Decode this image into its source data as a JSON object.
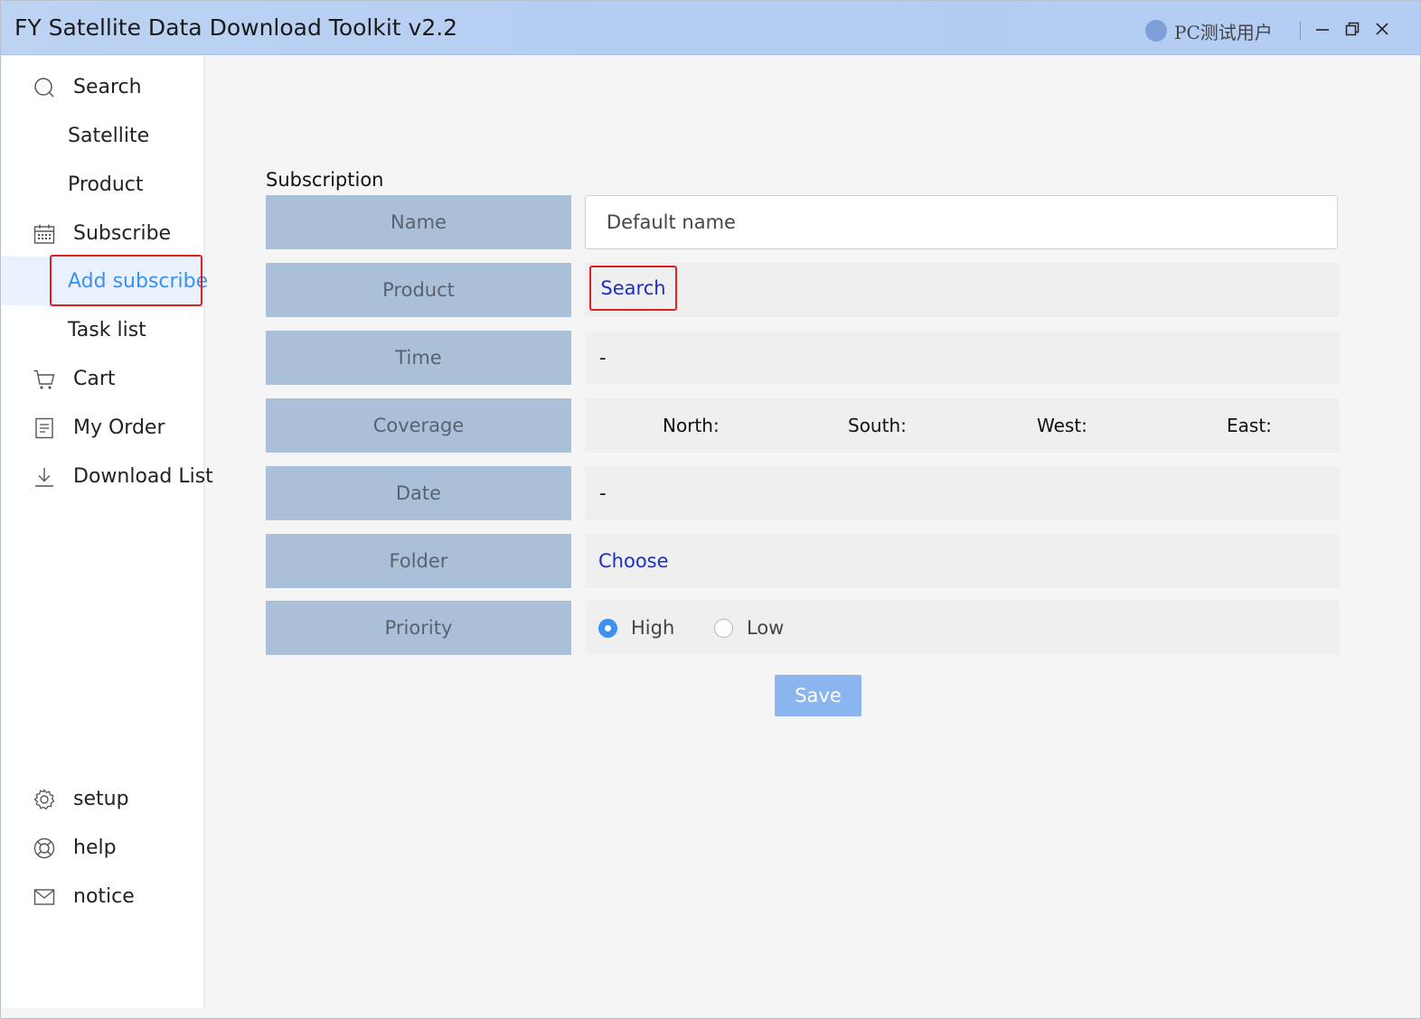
{
  "window": {
    "title": "FY Satellite Data Download Toolkit v2.2",
    "user_name": "PC测试用户"
  },
  "sidebar": {
    "items": [
      {
        "label": "Search",
        "icon": "search-icon"
      },
      {
        "label": "Satellite"
      },
      {
        "label": "Product"
      },
      {
        "label": "Subscribe",
        "icon": "calendar-icon"
      },
      {
        "label": "Add subscribe",
        "active": true
      },
      {
        "label": "Task list"
      },
      {
        "label": "Cart",
        "icon": "cart-icon"
      },
      {
        "label": "My Order",
        "icon": "document-icon"
      },
      {
        "label": "Download List",
        "icon": "download-icon"
      }
    ],
    "bottom": [
      {
        "label": "setup",
        "icon": "gear-icon"
      },
      {
        "label": "help",
        "icon": "lifebuoy-icon"
      },
      {
        "label": "notice",
        "icon": "mail-icon"
      }
    ]
  },
  "form": {
    "section_title": "Subscription",
    "labels": {
      "name": "Name",
      "product": "Product",
      "time": "Time",
      "coverage": "Coverage",
      "date": "Date",
      "folder": "Folder",
      "priority": "Priority"
    },
    "name_value": "Default name",
    "product_link": "Search",
    "time_value": "-",
    "coverage": {
      "north": "North:",
      "south": "South:",
      "west": "West:",
      "east": "East:"
    },
    "date_value": "-",
    "folder_link": "Choose",
    "priority_options": [
      {
        "label": "High",
        "selected": true
      },
      {
        "label": "Low",
        "selected": false
      }
    ],
    "save_label": "Save"
  },
  "colors": {
    "accent": "#3b91f0",
    "label_bg": "#aabfd8",
    "link": "#1a2fc8",
    "highlight_border": "#e02020",
    "save_bg": "#8bb5ee"
  }
}
